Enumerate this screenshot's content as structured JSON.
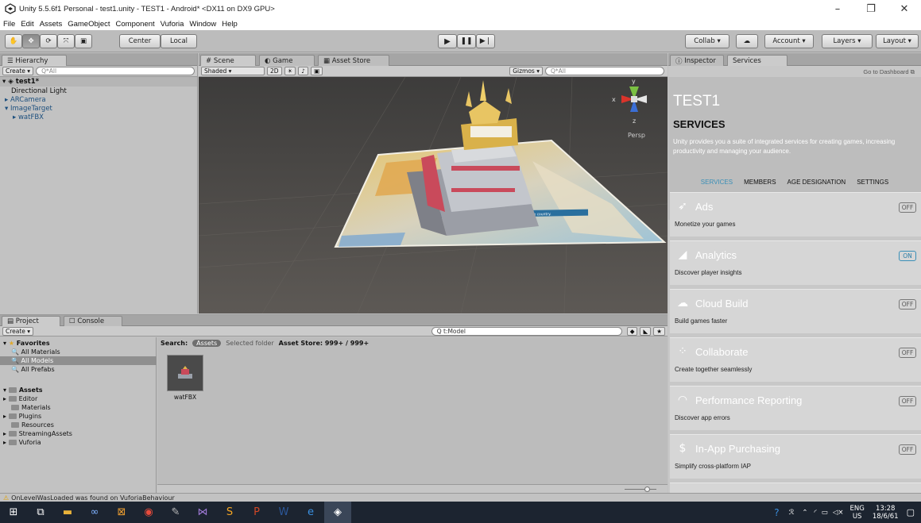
{
  "window": {
    "title": "Unity 5.5.6f1 Personal - test1.unity - TEST1 - Android* <DX11 on DX9 GPU>",
    "minimize": "–",
    "maximize": "❐",
    "close": "✕"
  },
  "menu": [
    "File",
    "Edit",
    "Assets",
    "GameObject",
    "Component",
    "Vuforia",
    "Window",
    "Help"
  ],
  "toolbar": {
    "hand_tool": "✋",
    "move_tool": "✥",
    "rotate_tool": "⟳",
    "scale_tool": "⤧",
    "rect_tool": "▣",
    "pivot_mode": "Center",
    "pivot_space": "Local",
    "play": "▶",
    "pause": "❚❚",
    "step": "▶❘",
    "collab": "Collab",
    "cloud": "☁",
    "account": "Account",
    "layers": "Layers",
    "layout": "Layout"
  },
  "hierarchy": {
    "tab": "Hierarchy",
    "create": "Create",
    "search_placeholder": "Q*All",
    "scene_name": "test1*",
    "items": [
      "Directional Light",
      "ARCamera",
      "ImageTarget",
      "watFBX"
    ]
  },
  "scene": {
    "tabs": [
      "Scene",
      "Game",
      "Asset Store"
    ],
    "shading": "Shaded",
    "mode_2d": "2D",
    "gizmos": "Gizmos",
    "search_placeholder": "Q*All",
    "persp": "Persp",
    "axis_y": "y",
    "axis_x": "x",
    "axis_z": "z",
    "banner_text": "Wat Phra Kaew - Important and famous places of the country."
  },
  "inspector": {
    "tabs": [
      "Inspector",
      "Services"
    ],
    "go_dashboard": "Go to Dashboard",
    "project_title": "TEST1",
    "services_title": "SERVICES",
    "intro": "Unity provides you a suite of integrated services for creating games, increasing productivity and managing your audience.",
    "nav": [
      "SERVICES",
      "MEMBERS",
      "AGE DESIGNATION",
      "SETTINGS"
    ],
    "services": [
      {
        "name": "Ads",
        "desc": "Monetize your games",
        "state": "OFF",
        "icon": "megaphone-icon"
      },
      {
        "name": "Analytics",
        "desc": "Discover player insights",
        "state": "ON",
        "icon": "chart-icon"
      },
      {
        "name": "Cloud Build",
        "desc": "Build games faster",
        "state": "OFF",
        "icon": "cloud-icon"
      },
      {
        "name": "Collaborate",
        "desc": "Create together seamlessly",
        "state": "OFF",
        "icon": "collab-icon"
      },
      {
        "name": "Performance Reporting",
        "desc": "Discover app errors",
        "state": "OFF",
        "icon": "gauge-icon"
      },
      {
        "name": "In-App Purchasing",
        "desc": "Simplify cross-platform IAP",
        "state": "OFF",
        "icon": "dollar-icon"
      }
    ]
  },
  "project": {
    "tabs": [
      "Project",
      "Console"
    ],
    "create": "Create",
    "search_value": "Q t:Model",
    "search_label": "Search:",
    "search_scope_assets": "Assets",
    "search_scope_folder": "Selected folder",
    "asset_store": "Asset Store: 999+ / 999+",
    "favorites": "Favorites",
    "favorite_items": [
      "All Materials",
      "All Models",
      "All Prefabs"
    ],
    "assets": "Assets",
    "asset_folders": [
      "Editor",
      "Materials",
      "Plugins",
      "Resources",
      "StreamingAssets",
      "Vuforia"
    ],
    "asset_item": "watFBX"
  },
  "status": {
    "message": "OnLevelWasLoaded was found on VuforiaBehaviour"
  },
  "taskbar": {
    "lang": "ENG",
    "region": "US",
    "time": "13:28",
    "date": "18/6/61"
  },
  "colors": {
    "accent_blue": "#3a8fb7",
    "services_header": "#bdbdbd",
    "taskbar": "#1c2430"
  }
}
